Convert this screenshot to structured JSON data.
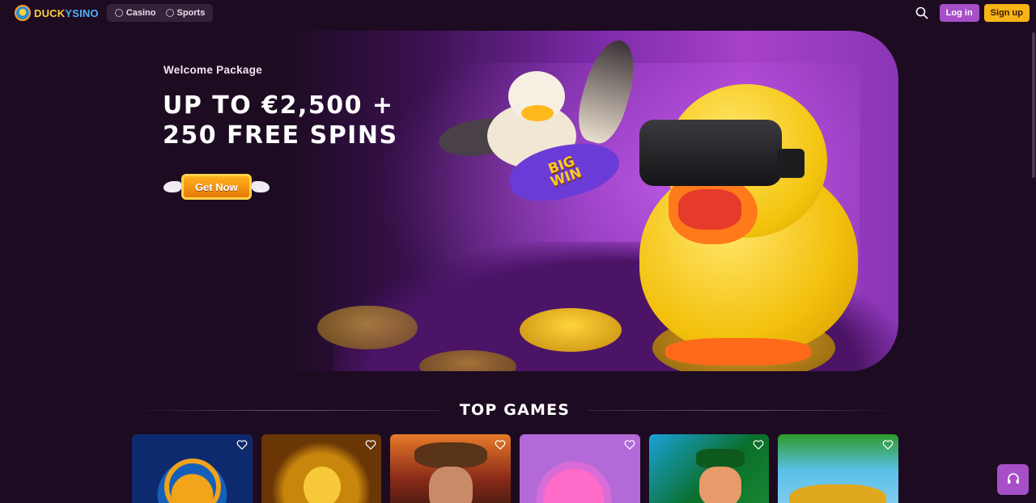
{
  "header": {
    "logo_text": "DUCKYSINO",
    "modes": [
      {
        "label": "Casino",
        "icon": "casino-chip-icon"
      },
      {
        "label": "Sports",
        "icon": "soccer-ball-icon"
      }
    ],
    "search_icon": "search-icon",
    "login_label": "Log in",
    "signup_label": "Sign up"
  },
  "hero": {
    "subtitle": "Welcome Package",
    "title_line1": "UP TO €2,500 +",
    "title_line2": "250 FREE SPINS",
    "cta_label": "Get Now",
    "fish_text_line1": "BIG",
    "fish_text_line2": "WIN"
  },
  "top_games": {
    "title": "TOP GAMES",
    "favorite_icon": "heart-icon",
    "games": [
      {
        "id": "g1"
      },
      {
        "id": "g2"
      },
      {
        "id": "g3"
      },
      {
        "id": "g4"
      },
      {
        "id": "g5"
      },
      {
        "id": "g6"
      }
    ]
  },
  "support_icon": "headset-icon",
  "colors": {
    "background": "#1d0b22",
    "login": "#a64fc8",
    "signup": "#f7b416",
    "cta": "#ffb21e"
  }
}
